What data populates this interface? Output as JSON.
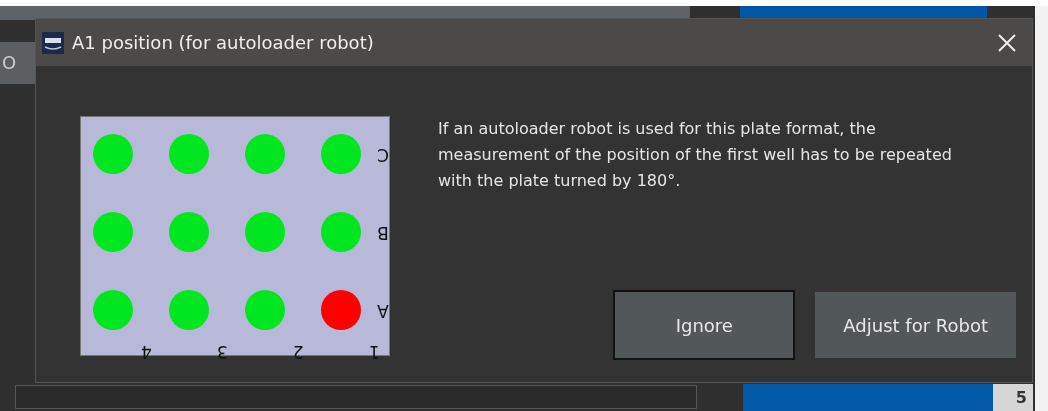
{
  "background": {
    "left_tab": "O",
    "bottom_cell": "5"
  },
  "dialog": {
    "title": "A1 position (for autoloader robot)",
    "message": "If an autoloader robot is used for this plate format, the measurement of the position of the first well has to be repeated with the plate turned by 180°.",
    "plate": {
      "row_labels": [
        "C",
        "B",
        "A"
      ],
      "column_labels": [
        "4",
        "3",
        "2",
        "1"
      ],
      "rows": [
        [
          {
            "color": "#00e620"
          },
          {
            "color": "#00e620"
          },
          {
            "color": "#00e620"
          },
          {
            "color": "#00e620"
          }
        ],
        [
          {
            "color": "#00e620"
          },
          {
            "color": "#00e620"
          },
          {
            "color": "#00e620"
          },
          {
            "color": "#00e620"
          }
        ],
        [
          {
            "color": "#00e620"
          },
          {
            "color": "#00e620"
          },
          {
            "color": "#00e620"
          },
          {
            "color": "#ff0000"
          }
        ]
      ]
    },
    "buttons": [
      {
        "label": "Ignore",
        "selected": true
      },
      {
        "label": "Adjust for Robot",
        "selected": false
      }
    ]
  }
}
